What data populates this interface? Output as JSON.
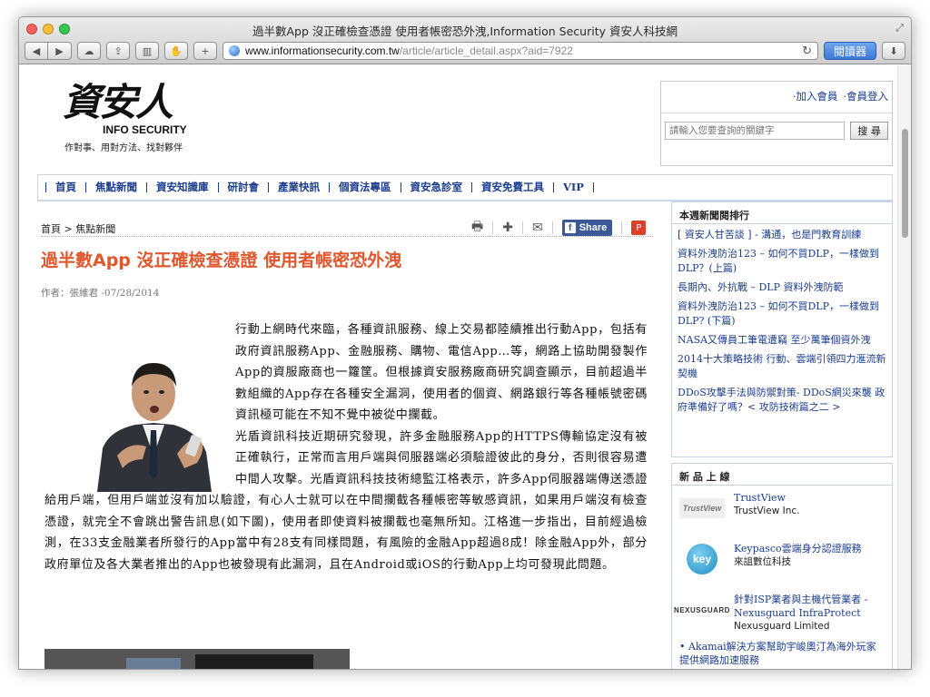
{
  "window": {
    "title": "過半數App 沒正確檢查憑證 使用者帳密恐外洩,Information Security 資安人科技網",
    "url_domain": "www.informationsecurity.com.tw",
    "url_path": "/article/article_detail.aspx?aid=7922",
    "reader_label": "閱讀器"
  },
  "logo": {
    "chars": "資安人",
    "english": "INFO SECURITY",
    "slogan": "作對事、用對方法、找對夥伴"
  },
  "member": {
    "join": "·加入會員",
    "login": "·會員登入",
    "search_placeholder": "請輸入您要查詢的關鍵字",
    "search_button": "搜 尋"
  },
  "nav": {
    "items": [
      "首頁",
      "焦點新聞",
      "資安知識庫",
      "研討會",
      "產業快訊",
      "個資法專區",
      "資安急診室",
      "資安免費工具",
      "VIP"
    ]
  },
  "breadcrumb": "首頁 > 焦點新聞",
  "share": {
    "facebook": "Share"
  },
  "article": {
    "title": "過半數App 沒正確檢查憑證 使用者帳密恐外洩",
    "byline": "作者：張維君 -07/28/2014",
    "p1": "行動上網時代來臨，各種資訊服務、線上交易都陸續推出行動App，包括有政府資訊服務App、金融服務、購物、電信App…等，網路上協助開發製作App的資服廠商也一籮筐。但根據資安服務廠商研究調查顯示，目前超過半數組織的App存在各種安全漏洞，使用者的個資、網路銀行等各種帳號密碼資訊極可能在不知不覺中被從中攔截。",
    "p2": "光盾資訊科技近期研究發現，許多金融服務App的HTTPS傳輸協定沒有被正確執行，正常而言用戶端與伺服器端必須驗證彼此的身分，否則很容易遭中間人攻擊。光盾資訊科技技術總監江格表示，許多App伺服器端傳送憑證給用戶端，但用戶端並沒有加以驗證，有心人士就可以在中間攔截各種帳密等敏感資訊，如果用戶端沒有檢查憑證，就完全不會跳出警告訊息(如下圖)，使用者即使資料被攔截也毫無所知。江格進一步指出，目前經過檢測，在33支金融業者所發行的App當中有28支有同樣問題，有風險的金融App超過8成！除金融App外，部分政府單位及各大業者推出的App也被發現有此漏洞，且在Android或iOS的行動App上均可發現此問題。"
  },
  "sidebar": {
    "rank_title": "本週新聞閱排行",
    "rank_items": [
      "[ 資安人甘苦談 ] - 溝通，也是門教育訓練",
      "資料外洩防治123 – 如何不買DLP，一樣做到DLP？(上篇)",
      "長期內、外抗戰 – DLP 資料外洩防範",
      "資料外洩防治123 – 如何不買DLP，一樣做到DLP? (下篇)",
      "NASA又傳員工筆電遭竊 至少萬筆個資外洩",
      "2014十大策略技術 行動、雲端引領四力滙流新契機",
      "DDoS攻擊手法與防禦對策- DDoS網災來襲  政府準備好了嗎？< 攻防技術篇之二 >"
    ],
    "new_title": "新 品 上 線",
    "products": [
      {
        "logo": "TrustView",
        "title": "TrustView",
        "company": "TrustView Inc."
      },
      {
        "logo": "key",
        "title": "Keypasco雲端身分認證服務",
        "company": "來詛數位科技"
      },
      {
        "logo": "NEXUSGUARD",
        "title": "針對ISP業者與主機代管業者 - Nexusguard InfraProtect",
        "company": "Nexusguard Limited"
      }
    ],
    "more_item": "• Akamai解決方案幫助宇峻奧汀為海外玩家提供網路加速服務"
  }
}
